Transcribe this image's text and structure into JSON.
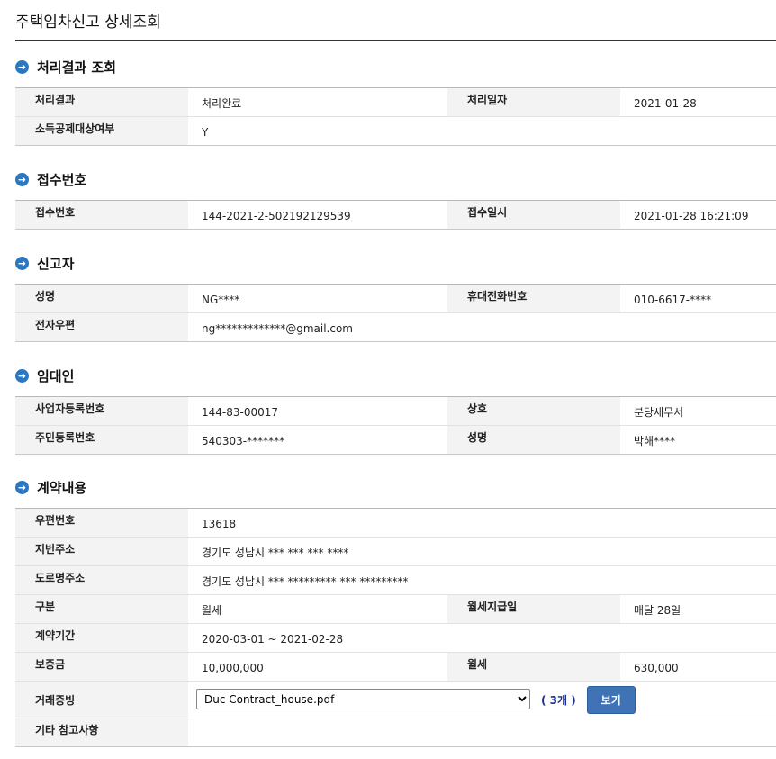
{
  "page": {
    "title": "주택임차신고 상세조회"
  },
  "sections": {
    "result": {
      "title": "처리결과 조회",
      "rows": [
        {
          "l1": "처리결과",
          "v1": "처리완료",
          "l2": "처리일자",
          "v2": "2021-01-28"
        },
        {
          "l1": "소득공제대상여부",
          "v1": "Y"
        }
      ]
    },
    "receipt": {
      "title": "접수번호",
      "rows": [
        {
          "l1": "접수번호",
          "v1": "144-2021-2-502192129539",
          "l2": "접수일시",
          "v2": "2021-01-28 16:21:09"
        }
      ]
    },
    "reporter": {
      "title": "신고자",
      "rows": [
        {
          "l1": "성명",
          "v1": "NG****",
          "l2": "휴대전화번호",
          "v2": "010-6617-****"
        },
        {
          "l1": "전자우편",
          "v1": "ng*************@gmail.com"
        }
      ]
    },
    "lessor": {
      "title": "임대인",
      "rows": [
        {
          "l1": "사업자등록번호",
          "v1": "144-83-00017",
          "l2": "상호",
          "v2": "분당세무서"
        },
        {
          "l1": "주민등록번호",
          "v1": "540303-*******",
          "l2": "성명",
          "v2": "박해****"
        }
      ]
    },
    "contract": {
      "title": "계약내용",
      "rows": [
        {
          "l1": "우편번호",
          "v1": "13618"
        },
        {
          "l1": "지번주소",
          "v1": "경기도 성남시 *** *** *** ****"
        },
        {
          "l1": "도로명주소",
          "v1": "경기도 성남시 *** ********* *** *********"
        },
        {
          "l1": "구분",
          "v1": "월세",
          "l2": "월세지급일",
          "v2": "매달 28일"
        },
        {
          "l1": "계약기간",
          "v1": "2020-03-01 ~ 2021-02-28"
        },
        {
          "l1": "보증금",
          "v1": "10,000,000",
          "l2": "월세",
          "v2": "630,000"
        },
        {
          "l1": "거래증빙"
        },
        {
          "l1": "기타 참고사항",
          "v1": ""
        }
      ],
      "evidence": {
        "selected_file": "Duc Contract_house.pdf",
        "count_label": "( 3개 )",
        "view_button": "보기"
      }
    }
  },
  "colors": {
    "accent_blue": "#2b78c2",
    "button_blue": "#3f73b6",
    "label_bg": "#f3f3f3",
    "count_text": "#1a2f8f"
  },
  "icons": {
    "section_bullet": "circle-arrow-right-icon"
  }
}
